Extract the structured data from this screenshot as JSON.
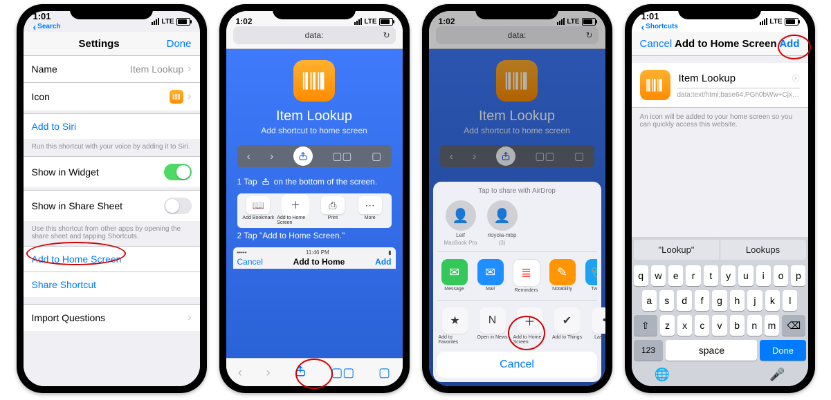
{
  "status": {
    "time": "1:01",
    "breadcrumb_search": "Search",
    "breadcrumb_shortcuts": "Shortcuts",
    "carrier": "LTE",
    "time2": "1:02"
  },
  "s1": {
    "title": "Settings",
    "done": "Done",
    "name_label": "Name",
    "name_value": "Item Lookup",
    "icon_label": "Icon",
    "add_siri": "Add to Siri",
    "siri_hint": "Run this shortcut with your voice by adding it to Siri.",
    "widget_label": "Show in Widget",
    "sheet_label": "Show in Share Sheet",
    "sheet_hint": "Use this shortcut from other apps by opening the share sheet and tapping Shortcuts.",
    "add_home": "Add to Home Screen",
    "share": "Share Shortcut",
    "import_q": "Import Questions"
  },
  "s2": {
    "url": "data:",
    "title": "Item Lookup",
    "subtitle": "Add shortcut to home screen",
    "step1_pre": "1   Tap",
    "step1_post": "on the bottom of the screen.",
    "action_items": [
      {
        "label": "Add Bookmark",
        "icon": "📖"
      },
      {
        "label": "Add to Home Screen",
        "icon": "＋"
      },
      {
        "label": "Print",
        "icon": "⎙"
      },
      {
        "label": "More",
        "icon": "⋯"
      }
    ],
    "step2": "2   Tap \"Add to Home Screen.\"",
    "mock_time": "11:46 PM",
    "mock_cancel": "Cancel",
    "mock_title": "Add to Home",
    "mock_add": "Add"
  },
  "s3": {
    "url": "data:",
    "title": "Item Lookup",
    "subtitle": "Add shortcut to home screen",
    "hint": "Tap to share with AirDrop",
    "airdrop": [
      {
        "name": "Leif",
        "sub": "MacBook Pro"
      },
      {
        "name": "rloyola-mbp",
        "sub": "(3)"
      }
    ],
    "apps": [
      {
        "name": "Message",
        "color": "#34c759",
        "glyph": "✉"
      },
      {
        "name": "Mail",
        "color": "#1f8fff",
        "glyph": "✉"
      },
      {
        "name": "Reminders",
        "color": "#ffffff",
        "glyph": "≣"
      },
      {
        "name": "Notability",
        "color": "#ff9500",
        "glyph": "✎"
      },
      {
        "name": "Twitter",
        "color": "#1da1f2",
        "glyph": "🐦"
      }
    ],
    "actions": [
      {
        "name": "Add to Favorites",
        "glyph": "★"
      },
      {
        "name": "Open in News",
        "glyph": "N"
      },
      {
        "name": "Add to Home Screen",
        "glyph": "＋"
      },
      {
        "name": "Add to Things",
        "glyph": "✔"
      },
      {
        "name": "LastPass",
        "glyph": "•"
      }
    ],
    "cancel": "Cancel"
  },
  "s4": {
    "cancel": "Cancel",
    "title": "Add to Home Screen",
    "add": "Add",
    "name_value": "Item Lookup",
    "url_value": "data:text/html;base64,PGh0bWw+Cjx…",
    "note": "An icon will be added to your home screen so you can quickly access this website.",
    "sugg": [
      "\"Lookup\"",
      "Lookups"
    ],
    "rows": [
      [
        "q",
        "w",
        "e",
        "r",
        "t",
        "y",
        "u",
        "i",
        "o",
        "p"
      ],
      [
        "a",
        "s",
        "d",
        "f",
        "g",
        "h",
        "j",
        "k",
        "l"
      ],
      [
        "z",
        "x",
        "c",
        "v",
        "b",
        "n",
        "m"
      ]
    ],
    "shift": "⇧",
    "bksp": "⌫",
    "numkey": "123",
    "space": "space",
    "done": "Done",
    "globe": "🌐",
    "mic": "🎤"
  }
}
